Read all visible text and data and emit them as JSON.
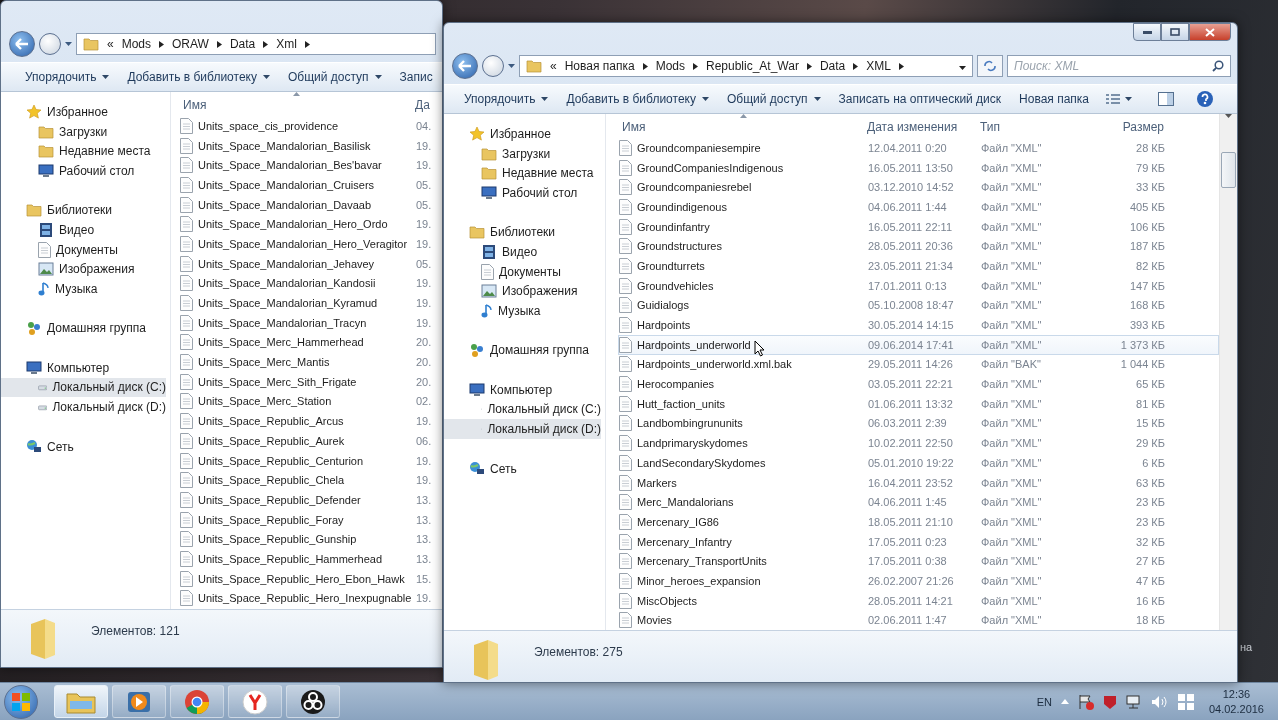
{
  "windows": [
    {
      "address": {
        "overflow": "«",
        "crumbs": [
          "Mods",
          "ORAW",
          "Data",
          "Xml"
        ]
      },
      "toolbar": [
        {
          "label": "Упорядочить",
          "dropdown": true
        },
        {
          "label": "Добавить в библиотеку",
          "dropdown": true
        },
        {
          "label": "Общий доступ",
          "dropdown": true
        },
        {
          "label": "Запис",
          "dropdown": false
        }
      ],
      "nav": [
        {
          "label": "Избранное",
          "selected": false,
          "children": [
            {
              "label": "Загрузки",
              "selected": false
            },
            {
              "label": "Недавние места",
              "selected": false
            },
            {
              "label": "Рабочий стол",
              "selected": false
            }
          ]
        },
        {
          "label": "Библиотеки",
          "selected": false,
          "children": [
            {
              "label": "Видео",
              "selected": false
            },
            {
              "label": "Документы",
              "selected": false
            },
            {
              "label": "Изображения",
              "selected": false
            },
            {
              "label": "Музыка",
              "selected": false
            }
          ]
        },
        {
          "label": "Домашняя группа",
          "selected": false
        },
        {
          "label": "Компьютер",
          "selected": false,
          "children": [
            {
              "label": "Локальный диск (C:)",
              "selected": true
            },
            {
              "label": "Локальный диск (D:)",
              "selected": false
            }
          ]
        },
        {
          "label": "Сеть",
          "selected": false
        }
      ],
      "columns": [
        "Имя",
        "Да"
      ],
      "rows": [
        {
          "cells": [
            "Units_space_cis_providence",
            "04."
          ]
        },
        {
          "cells": [
            "Units_Space_Mandalorian_Basilisk",
            "19."
          ]
        },
        {
          "cells": [
            "Units_Space_Mandalorian_Bes'bavar",
            "19."
          ]
        },
        {
          "cells": [
            "Units_Space_Mandalorian_Cruisers",
            "05."
          ]
        },
        {
          "cells": [
            "Units_Space_Mandalorian_Davaab",
            "05."
          ]
        },
        {
          "cells": [
            "Units_Space_Mandalorian_Hero_Ordo",
            "19."
          ]
        },
        {
          "cells": [
            "Units_Space_Mandalorian_Hero_Veragitor",
            "19."
          ]
        },
        {
          "cells": [
            "Units_Space_Mandalorian_Jehavey",
            "05."
          ]
        },
        {
          "cells": [
            "Units_Space_Mandalorian_Kandosii",
            "19."
          ]
        },
        {
          "cells": [
            "Units_Space_Mandalorian_Kyramud",
            "19."
          ]
        },
        {
          "cells": [
            "Units_Space_Mandalorian_Tracyn",
            "19."
          ]
        },
        {
          "cells": [
            "Units_Space_Merc_Hammerhead",
            "20."
          ]
        },
        {
          "cells": [
            "Units_Space_Merc_Mantis",
            "20."
          ]
        },
        {
          "cells": [
            "Units_Space_Merc_Sith_Frigate",
            "20."
          ]
        },
        {
          "cells": [
            "Units_Space_Merc_Station",
            "02."
          ]
        },
        {
          "cells": [
            "Units_Space_Republic_Arcus",
            "19."
          ]
        },
        {
          "cells": [
            "Units_Space_Republic_Aurek",
            "06."
          ]
        },
        {
          "cells": [
            "Units_Space_Republic_Centurion",
            "19."
          ]
        },
        {
          "cells": [
            "Units_Space_Republic_Chela",
            "19."
          ]
        },
        {
          "cells": [
            "Units_Space_Republic_Defender",
            "13."
          ]
        },
        {
          "cells": [
            "Units_Space_Republic_Foray",
            "13."
          ]
        },
        {
          "cells": [
            "Units_Space_Republic_Gunship",
            "13."
          ]
        },
        {
          "cells": [
            "Units_Space_Republic_Hammerhead",
            "13."
          ]
        },
        {
          "cells": [
            "Units_Space_Republic_Hero_Ebon_Hawk",
            "15."
          ]
        },
        {
          "cells": [
            "Units_Space_Republic_Hero_Inexpugnable",
            "19."
          ]
        }
      ],
      "status": "Элементов: 121"
    },
    {
      "address": {
        "overflow": "«",
        "crumbs": [
          "Новая папка",
          "Mods",
          "Republic_At_War",
          "Data",
          "XML"
        ]
      },
      "search": {
        "placeholder": "Поиск: XML"
      },
      "toolbar": [
        {
          "label": "Упорядочить",
          "dropdown": true
        },
        {
          "label": "Добавить в библиотеку",
          "dropdown": true
        },
        {
          "label": "Общий доступ",
          "dropdown": true
        },
        {
          "label": "Записать на оптический диск",
          "dropdown": false
        },
        {
          "label": "Новая папка",
          "dropdown": false
        }
      ],
      "nav": [
        {
          "label": "Избранное",
          "selected": false,
          "children": [
            {
              "label": "Загрузки",
              "selected": false
            },
            {
              "label": "Недавние места",
              "selected": false
            },
            {
              "label": "Рабочий стол",
              "selected": false
            }
          ]
        },
        {
          "label": "Библиотеки",
          "selected": false,
          "children": [
            {
              "label": "Видео",
              "selected": false
            },
            {
              "label": "Документы",
              "selected": false
            },
            {
              "label": "Изображения",
              "selected": false
            },
            {
              "label": "Музыка",
              "selected": false
            }
          ]
        },
        {
          "label": "Домашняя группа",
          "selected": false
        },
        {
          "label": "Компьютер",
          "selected": false,
          "children": [
            {
              "label": "Локальный диск (C:)",
              "selected": false
            },
            {
              "label": "Локальный диск (D:)",
              "selected": true
            }
          ]
        },
        {
          "label": "Сеть",
          "selected": false
        }
      ],
      "columns": [
        "Имя",
        "Дата изменения",
        "Тип",
        "Размер"
      ],
      "rows": [
        {
          "cells": [
            "Groundcompaniesempire",
            "12.04.2011 0:20",
            "Файл \"XML\"",
            "28 КБ"
          ],
          "hovered": false
        },
        {
          "cells": [
            "GroundCompaniesIndigenous",
            "16.05.2011 13:50",
            "Файл \"XML\"",
            "79 КБ"
          ],
          "hovered": false
        },
        {
          "cells": [
            "Groundcompaniesrebel",
            "03.12.2010 14:52",
            "Файл \"XML\"",
            "33 КБ"
          ],
          "hovered": false
        },
        {
          "cells": [
            "Groundindigenous",
            "04.06.2011 1:44",
            "Файл \"XML\"",
            "405 КБ"
          ],
          "hovered": false
        },
        {
          "cells": [
            "Groundinfantry",
            "16.05.2011 22:11",
            "Файл \"XML\"",
            "106 КБ"
          ],
          "hovered": false
        },
        {
          "cells": [
            "Groundstructures",
            "28.05.2011 20:36",
            "Файл \"XML\"",
            "187 КБ"
          ],
          "hovered": false
        },
        {
          "cells": [
            "Groundturrets",
            "23.05.2011 21:34",
            "Файл \"XML\"",
            "82 КБ"
          ],
          "hovered": false
        },
        {
          "cells": [
            "Groundvehicles",
            "17.01.2011 0:13",
            "Файл \"XML\"",
            "147 КБ"
          ],
          "hovered": false
        },
        {
          "cells": [
            "Guidialogs",
            "05.10.2008 18:47",
            "Файл \"XML\"",
            "168 КБ"
          ],
          "hovered": false
        },
        {
          "cells": [
            "Hardpoints",
            "30.05.2014 14:15",
            "Файл \"XML\"",
            "393 КБ"
          ],
          "hovered": false
        },
        {
          "cells": [
            "Hardpoints_underworld",
            "09.06.2014 17:41",
            "Файл \"XML\"",
            "1 373 КБ"
          ],
          "hovered": true
        },
        {
          "cells": [
            "Hardpoints_underworld.xml.bak",
            "29.05.2011 14:26",
            "Файл \"BAK\"",
            "1 044 КБ"
          ],
          "hovered": false
        },
        {
          "cells": [
            "Herocompanies",
            "03.05.2011 22:21",
            "Файл \"XML\"",
            "65 КБ"
          ],
          "hovered": false
        },
        {
          "cells": [
            "Hutt_faction_units",
            "01.06.2011 13:32",
            "Файл \"XML\"",
            "81 КБ"
          ],
          "hovered": false
        },
        {
          "cells": [
            "Landbombingrununits",
            "06.03.2011 2:39",
            "Файл \"XML\"",
            "15 КБ"
          ],
          "hovered": false
        },
        {
          "cells": [
            "Landprimaryskydomes",
            "10.02.2011 22:50",
            "Файл \"XML\"",
            "29 КБ"
          ],
          "hovered": false
        },
        {
          "cells": [
            "LandSecondarySkydomes",
            "05.01.2010 19:22",
            "Файл \"XML\"",
            "6 КБ"
          ],
          "hovered": false
        },
        {
          "cells": [
            "Markers",
            "16.04.2011 23:52",
            "Файл \"XML\"",
            "63 КБ"
          ],
          "hovered": false
        },
        {
          "cells": [
            "Merc_Mandalorians",
            "04.06.2011 1:45",
            "Файл \"XML\"",
            "23 КБ"
          ],
          "hovered": false
        },
        {
          "cells": [
            "Mercenary_IG86",
            "18.05.2011 21:10",
            "Файл \"XML\"",
            "23 КБ"
          ],
          "hovered": false
        },
        {
          "cells": [
            "Mercenary_Infantry",
            "17.05.2011 0:23",
            "Файл \"XML\"",
            "32 КБ"
          ],
          "hovered": false
        },
        {
          "cells": [
            "Mercenary_TransportUnits",
            "17.05.2011 0:38",
            "Файл \"XML\"",
            "27 КБ"
          ],
          "hovered": false
        },
        {
          "cells": [
            "Minor_heroes_expansion",
            "26.02.2007 21:26",
            "Файл \"XML\"",
            "47 КБ"
          ],
          "hovered": false
        },
        {
          "cells": [
            "MiscObjects",
            "28.05.2011 14:21",
            "Файл \"XML\"",
            "16 КБ"
          ],
          "hovered": false
        },
        {
          "cells": [
            "Movies",
            "02.06.2011 1:47",
            "Файл \"XML\"",
            "18 КБ"
          ],
          "hovered": false
        }
      ],
      "status": "Элементов: 275"
    }
  ],
  "desktop_text": "на",
  "taskbar": {
    "apps": [
      {
        "selected": true
      },
      {
        "selected": false
      },
      {
        "selected": false
      },
      {
        "selected": false
      },
      {
        "selected": false
      }
    ],
    "language": "EN",
    "time": "12:36",
    "date": "04.02.2016"
  }
}
